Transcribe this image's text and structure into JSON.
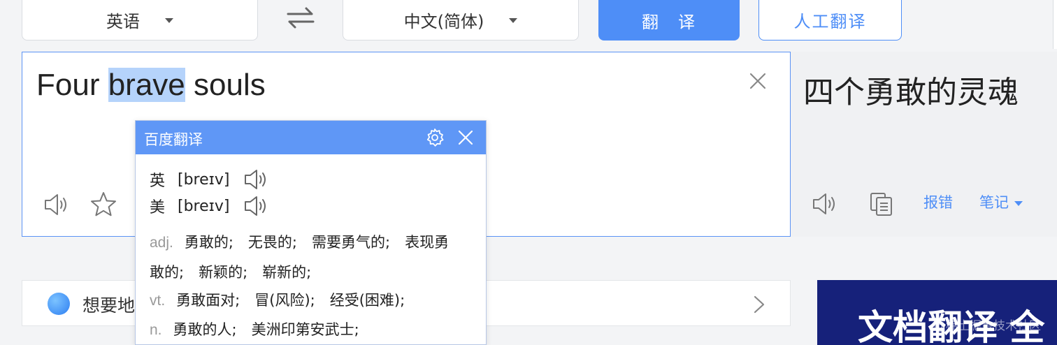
{
  "lang_bar": {
    "source_lang": "英语",
    "target_lang": "中文(简体)",
    "translate_label": "翻　译",
    "human_translate_label": "人工翻译"
  },
  "input": {
    "text_before": "Four ",
    "text_selected": "brave",
    "text_after": " souls"
  },
  "result": {
    "text": "四个勇敢的灵魂",
    "report_error_label": "报错",
    "notes_label": "笔记"
  },
  "popup": {
    "title": "百度翻译",
    "uk_label": "英",
    "uk_phonetic": "[breɪv]",
    "us_label": "美",
    "us_phonetic": "[breɪv]",
    "definitions": [
      {
        "pos": "adj.",
        "line1": "勇敢的;　无畏的;　需要勇气的;　表现勇",
        "line2": "敢的;　新颖的;　崭新的;"
      },
      {
        "pos": "vt.",
        "line1": "勇敢面对;　冒(风险);　经受(困难);"
      },
      {
        "pos": "n.",
        "line1": "勇敢的人;　美洲印第安武士;"
      }
    ]
  },
  "banner": {
    "text": "想要地"
  },
  "ad": {
    "text": "文档翻译 全",
    "watermark": "@稀土掘金技术社区"
  },
  "colors": {
    "accent": "#4e8ef7",
    "popup_header": "#5f97f6",
    "selection": "#b5d3fb",
    "ad_bg": "#16217a"
  }
}
